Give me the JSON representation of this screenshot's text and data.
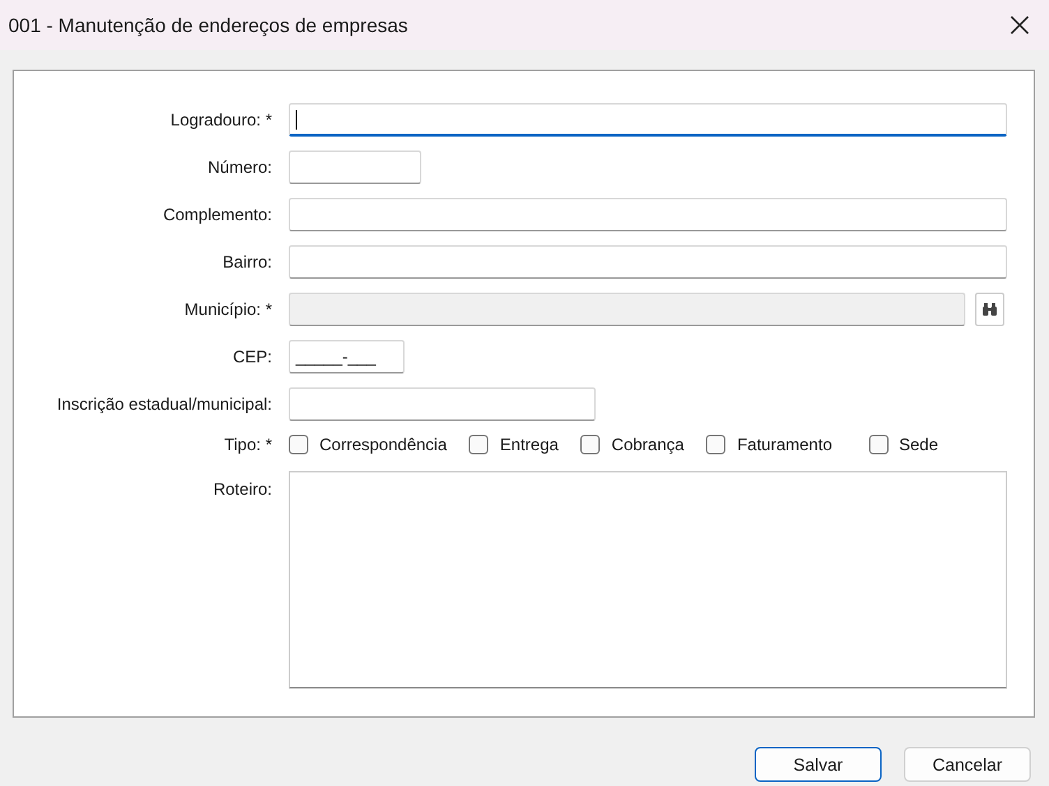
{
  "window": {
    "title": "001 - Manutenção de endereços de empresas"
  },
  "fields": [
    {
      "label": "Logradouro: *",
      "kind": "text",
      "focused": true,
      "disabled": false
    },
    {
      "label": "Número:",
      "kind": "text",
      "focused": false,
      "disabled": false
    },
    {
      "label": "Complemento:",
      "kind": "text",
      "focused": false,
      "disabled": false
    },
    {
      "label": "Bairro:",
      "kind": "text",
      "focused": false,
      "disabled": false
    },
    {
      "label": "Município: *",
      "kind": "lookup",
      "focused": false,
      "disabled": true
    },
    {
      "label": "CEP:",
      "kind": "masked",
      "focused": false,
      "disabled": false,
      "value": "_____-___"
    },
    {
      "label": "Inscrição estadual/municipal:",
      "kind": "text",
      "focused": false,
      "disabled": false
    }
  ],
  "tipo": {
    "label": "Tipo: *",
    "options": [
      {
        "label": "Correspondência",
        "checked": false
      },
      {
        "label": "Entrega",
        "checked": false
      },
      {
        "label": "Cobrança",
        "checked": false
      },
      {
        "label": "Faturamento",
        "checked": false
      },
      {
        "label": "Sede",
        "checked": false
      }
    ]
  },
  "roteiro": {
    "label": "Roteiro:"
  },
  "buttons": [
    {
      "label": "Salvar",
      "default": true
    },
    {
      "label": "Cancelar",
      "default": false
    }
  ]
}
